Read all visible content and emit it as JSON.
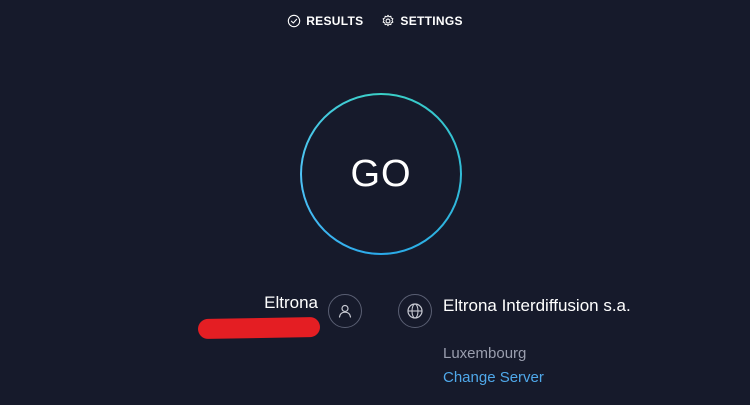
{
  "nav": {
    "results_label": "RESULTS",
    "settings_label": "SETTINGS"
  },
  "go_button": {
    "label": "GO"
  },
  "isp": {
    "name": "Eltrona"
  },
  "server": {
    "name": "Eltrona Interdiffusion s.a.",
    "location": "Luxembourg",
    "change_label": "Change Server"
  },
  "icons": {
    "results": "check-circle-icon",
    "settings": "gear-icon",
    "user": "user-icon",
    "server": "globe-icon"
  },
  "colors": {
    "background": "#161a2b",
    "ring_start": "#3ad0c6",
    "ring_end": "#2aa9ea",
    "link": "#4fa8ea",
    "muted_text": "#9a9eae",
    "redaction": "#e41e23"
  }
}
